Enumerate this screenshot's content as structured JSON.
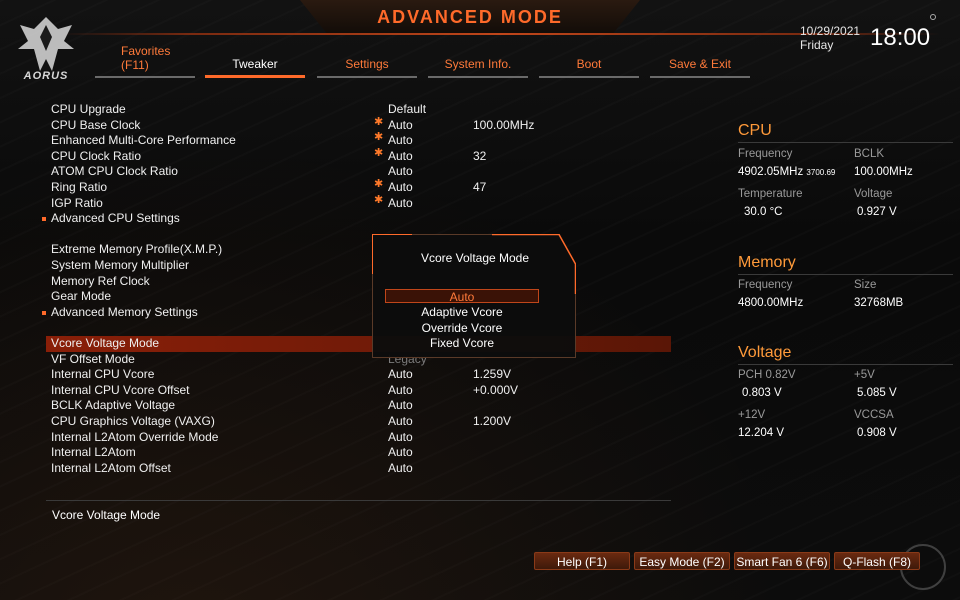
{
  "header": {
    "mode_title": "ADVANCED MODE",
    "logo_text": "AORUS",
    "date": "10/29/2021",
    "day": "Friday",
    "time": "18:00"
  },
  "tabs": [
    {
      "label": "Favorites",
      "sub": "(F11)"
    },
    {
      "label": "Tweaker",
      "active": true
    },
    {
      "label": "Settings"
    },
    {
      "label": "System Info."
    },
    {
      "label": "Boot"
    },
    {
      "label": "Save & Exit"
    }
  ],
  "settings": [
    {
      "label": "CPU Upgrade",
      "value": "Default",
      "value2": "",
      "star": false
    },
    {
      "label": "CPU Base Clock",
      "value": "Auto",
      "value2": "100.00MHz",
      "star": true
    },
    {
      "label": "Enhanced Multi-Core Performance",
      "value": "Auto",
      "value2": "",
      "star": true
    },
    {
      "label": "CPU Clock Ratio",
      "value": "Auto",
      "value2": "32",
      "star": true
    },
    {
      "label": "ATOM CPU Clock Ratio",
      "value": "Auto",
      "value2": "",
      "star": false
    },
    {
      "label": "Ring Ratio",
      "value": "Auto",
      "value2": "47",
      "star": true
    },
    {
      "label": "IGP Ratio",
      "value": "Auto",
      "value2": "",
      "star": true
    },
    {
      "label": "Advanced CPU Settings",
      "value": "",
      "value2": "",
      "bullet": true
    },
    {
      "label": "Extreme Memory Profile(X.M.P.)",
      "value": "",
      "value2": ""
    },
    {
      "label": "System Memory Multiplier",
      "value": "",
      "value2": ""
    },
    {
      "label": "Memory Ref Clock",
      "value": "",
      "value2": ""
    },
    {
      "label": "Gear Mode",
      "value": "",
      "value2": ""
    },
    {
      "label": "Advanced Memory Settings",
      "value": "",
      "value2": "",
      "bullet": true
    },
    {
      "label": "Vcore Voltage Mode",
      "value": "",
      "value2": "",
      "selected": true
    },
    {
      "label": "VF Offset Mode",
      "value": "Legacy",
      "value2": "",
      "dim": true
    },
    {
      "label": "Internal CPU Vcore",
      "value": "Auto",
      "value2": "1.259V"
    },
    {
      "label": "Internal CPU Vcore Offset",
      "value": "Auto",
      "value2": "+0.000V"
    },
    {
      "label": "BCLK Adaptive Voltage",
      "value": "Auto",
      "value2": ""
    },
    {
      "label": "CPU Graphics Voltage (VAXG)",
      "value": "Auto",
      "value2": "1.200V"
    },
    {
      "label": "Internal L2Atom Override Mode",
      "value": "Auto",
      "value2": ""
    },
    {
      "label": "Internal L2Atom",
      "value": "Auto",
      "value2": ""
    },
    {
      "label": "Internal L2Atom Offset",
      "value": "Auto",
      "value2": ""
    }
  ],
  "description": "Vcore Voltage Mode",
  "popup": {
    "title": "Vcore Voltage Mode",
    "options": [
      "Auto",
      "Adaptive Vcore",
      "Override Vcore",
      "Fixed Vcore"
    ],
    "selected_index": 0
  },
  "cpu": {
    "title": "CPU",
    "frequency_label": "Frequency",
    "frequency": "4902.05MHz",
    "frequency_small": "3700.69",
    "bclk_label": "BCLK",
    "bclk": "100.00MHz",
    "temperature_label": "Temperature",
    "temperature": "30.0 °C",
    "voltage_label": "Voltage",
    "voltage": "0.927 V"
  },
  "memory": {
    "title": "Memory",
    "frequency_label": "Frequency",
    "frequency": "4800.00MHz",
    "size_label": "Size",
    "size": "32768MB"
  },
  "voltage": {
    "title": "Voltage",
    "pch_label": "PCH 0.82V",
    "pch": "0.803 V",
    "p5v_label": "+5V",
    "p5v": "5.085 V",
    "p12v_label": "+12V",
    "p12v": "12.204 V",
    "vccsa_label": "VCCSA",
    "vccsa": "0.908 V"
  },
  "hotkeys": [
    "Help (F1)",
    "Easy Mode (F2)",
    "Smart Fan 6 (F6)",
    "Q-Flash (F8)"
  ],
  "colors": {
    "accent": "#ff6a2a",
    "selected_row": "#8a1f08",
    "section_title": "#ff9a3a"
  }
}
